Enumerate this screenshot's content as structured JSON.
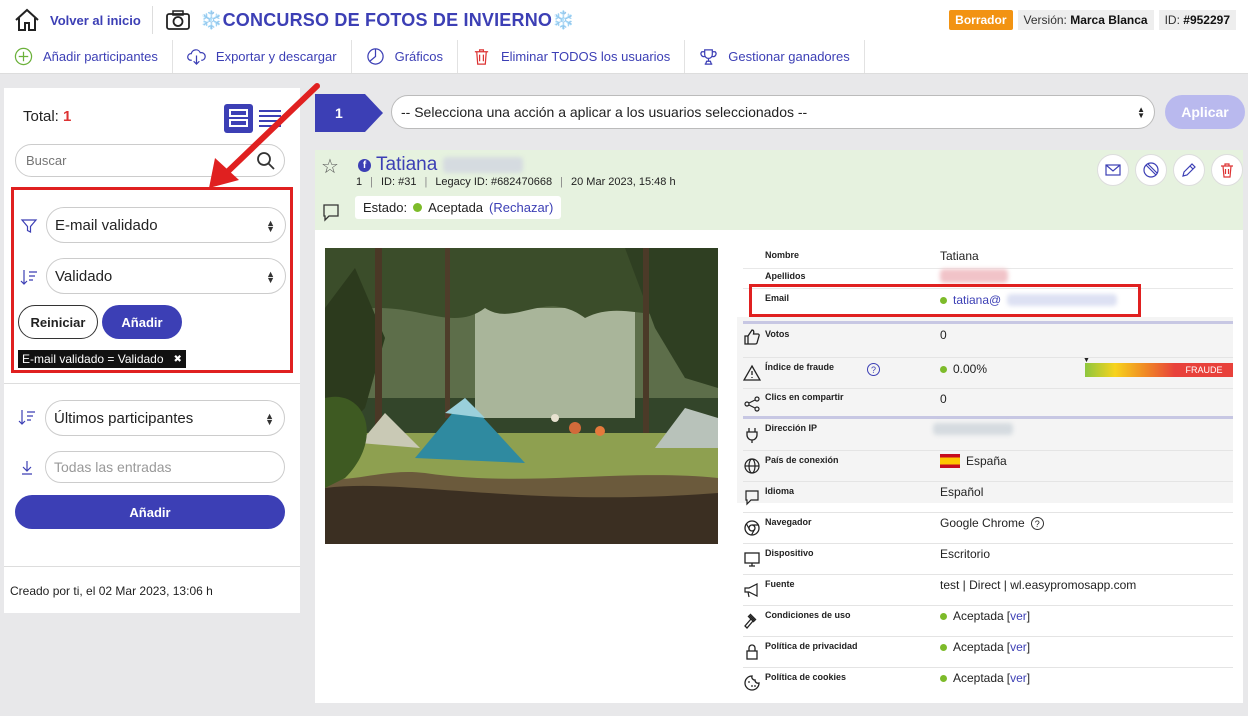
{
  "header": {
    "back_label": "Volver al inicio",
    "title": "❄️CONCURSO DE FOTOS DE INVIERNO❄️",
    "status_badge": "Borrador",
    "version_label": "Versión:",
    "version_value": "Marca Blanca",
    "id_label": "ID:",
    "id_value": "#952297"
  },
  "toolbar": {
    "items": [
      {
        "label": "Añadir participantes",
        "icon": "plus-circle-icon"
      },
      {
        "label": "Exportar y descargar",
        "icon": "cloud-download-icon"
      },
      {
        "label": "Gráficos",
        "icon": "pie-chart-icon"
      },
      {
        "label": "Eliminar TODOS los usuarios",
        "icon": "trash-icon"
      },
      {
        "label": "Gestionar ganadores",
        "icon": "trophy-icon"
      }
    ]
  },
  "sidebar": {
    "total_label": "Total:",
    "total_value": "1",
    "search_placeholder": "Buscar",
    "filter_field": "E-mail validado",
    "filter_value": "Validado",
    "reset_label": "Reiniciar",
    "add_label": "Añadir",
    "active_tag": "E-mail validado = Validado",
    "sort_field": "Últimos participantes",
    "entries_placeholder": "Todas las entradas",
    "add2_label": "Añadir",
    "created": "Creado por ti, el 02 Mar 2023, 13:06 h"
  },
  "actionbar": {
    "count": "1",
    "placeholder": "-- Selecciona una acción a aplicar a los usuarios seleccionados --",
    "apply_label": "Aplicar"
  },
  "participant": {
    "name": "Tatiana",
    "num": "1",
    "id": "ID: #31",
    "legacy": "Legacy ID: #682470668",
    "date": "20 Mar 2023, 15:48 h",
    "estado_label": "Estado:",
    "estado_value": "Aceptada",
    "reject_label": "(Rechazar)"
  },
  "details": {
    "nombre_label": "Nombre",
    "nombre": "Tatiana",
    "apellidos_label": "Apellidos",
    "email_label": "Email",
    "email": "tatiana@",
    "votos_label": "Votos",
    "votos": "0",
    "fraude_label": "Índice de fraude",
    "fraude": "0.00%",
    "fraude_tag": "FRAUDE",
    "clics_label": "Clics en compartir",
    "clics": "0",
    "ip_label": "Dirección IP",
    "pais_label": "País de conexión",
    "pais": "España",
    "idioma_label": "Idioma",
    "idioma": "Español",
    "nav_label": "Navegador",
    "nav": "Google Chrome",
    "disp_label": "Dispositivo",
    "disp": "Escritorio",
    "fuente_label": "Fuente",
    "fuente": "test | Direct | wl.easypromosapp.com",
    "cond_label": "Condiciones de uso",
    "cond": "Aceptada",
    "priv_label": "Política de privacidad",
    "priv": "Aceptada",
    "cook_label": "Política de cookies",
    "cook": "Aceptada",
    "ver_label": "ver"
  }
}
